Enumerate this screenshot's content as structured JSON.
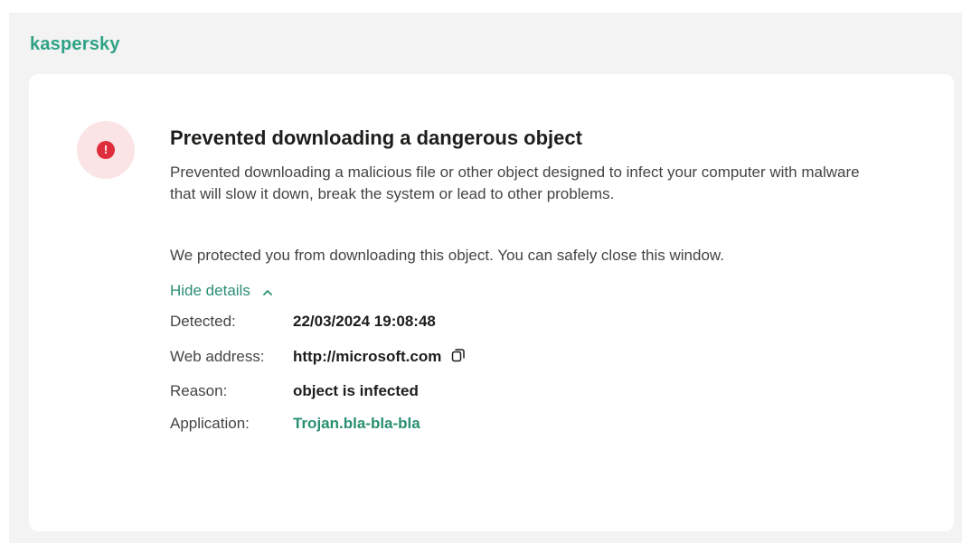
{
  "brand": {
    "name": "kaspersky",
    "color": "#2fa286"
  },
  "alert": {
    "icon": "exclamation-icon",
    "icon_glyph": "!",
    "status_color": "#df2d3d",
    "title": "Prevented downloading a dangerous object",
    "description": "Prevented downloading a malicious file or other object designed to infect your computer with malware that will slow it down, break the system or lead to other problems.",
    "note": "We protected you from downloading this object. You can safely close this window.",
    "toggle_label": "Hide details",
    "toggle_icon": "chevron-up-icon"
  },
  "details": {
    "detected": {
      "label": "Detected:",
      "value": "22/03/2024 19:08:48"
    },
    "web_address": {
      "label": "Web address:",
      "value": "http://microsoft.com",
      "action_icon": "copy-icon"
    },
    "reason": {
      "label": "Reason:",
      "value": "object is infected"
    },
    "application": {
      "label": "Application:",
      "value": "Trojan.bla-bla-bla"
    }
  },
  "colors": {
    "link": "#2a8f72",
    "badge_background": "#fbe4e5"
  }
}
